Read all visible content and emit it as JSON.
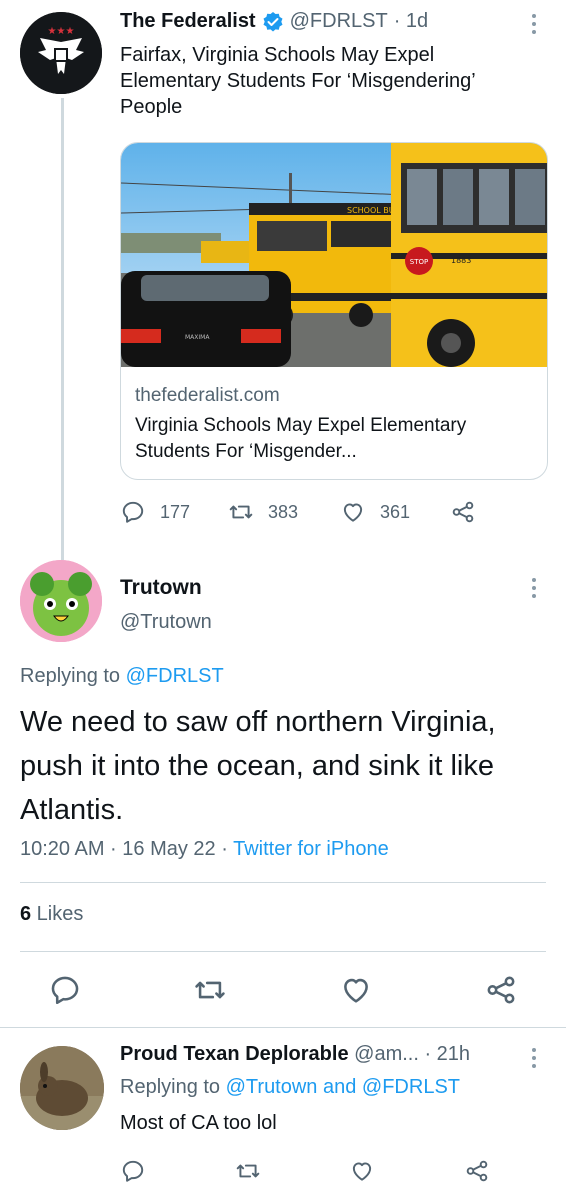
{
  "tweet1": {
    "name": "The Federalist",
    "handle": "@FDRLST",
    "time": "· 1d",
    "text": "Fairfax, Virginia Schools May Expel Elementary Students For ‘Misgendering’ People",
    "card": {
      "domain": "thefederalist.com",
      "title": "Virginia Schools May Expel Elementary Students For ‘Misgender...",
      "image_label": "SCHOOL BUS",
      "stop_label": "STOP",
      "bus_number": "1883",
      "car_label": "MAXIMA"
    },
    "replies": "177",
    "retweets": "383",
    "likes": "361"
  },
  "tweet2": {
    "name": "Trutown",
    "handle": "@Trutown",
    "replying_prefix": "Replying to",
    "replying_to": "@FDRLST",
    "text": "We need to saw off northern Virginia, push it into the ocean, and sink it like Atlantis.",
    "timestamp": "10:20 AM · 16 May 22 · ",
    "source": "Twitter for iPhone",
    "likes_count": "6",
    "likes_label": " Likes"
  },
  "tweet3": {
    "name": "Proud Texan Deplorable",
    "handle": "@am... · 21h",
    "replying_prefix": "Replying to",
    "replying_to": "@Trutown and @FDRLST",
    "text": "Most of CA too lol"
  },
  "colors": {
    "link": "#1d9bf0",
    "muted": "#536471",
    "text": "#0f1419",
    "divider": "#cfd9de",
    "bus_yellow": "#f2b90c"
  },
  "icons": [
    "verified-badge-icon",
    "more-icon",
    "reply-icon",
    "retweet-icon",
    "like-icon",
    "share-icon"
  ]
}
